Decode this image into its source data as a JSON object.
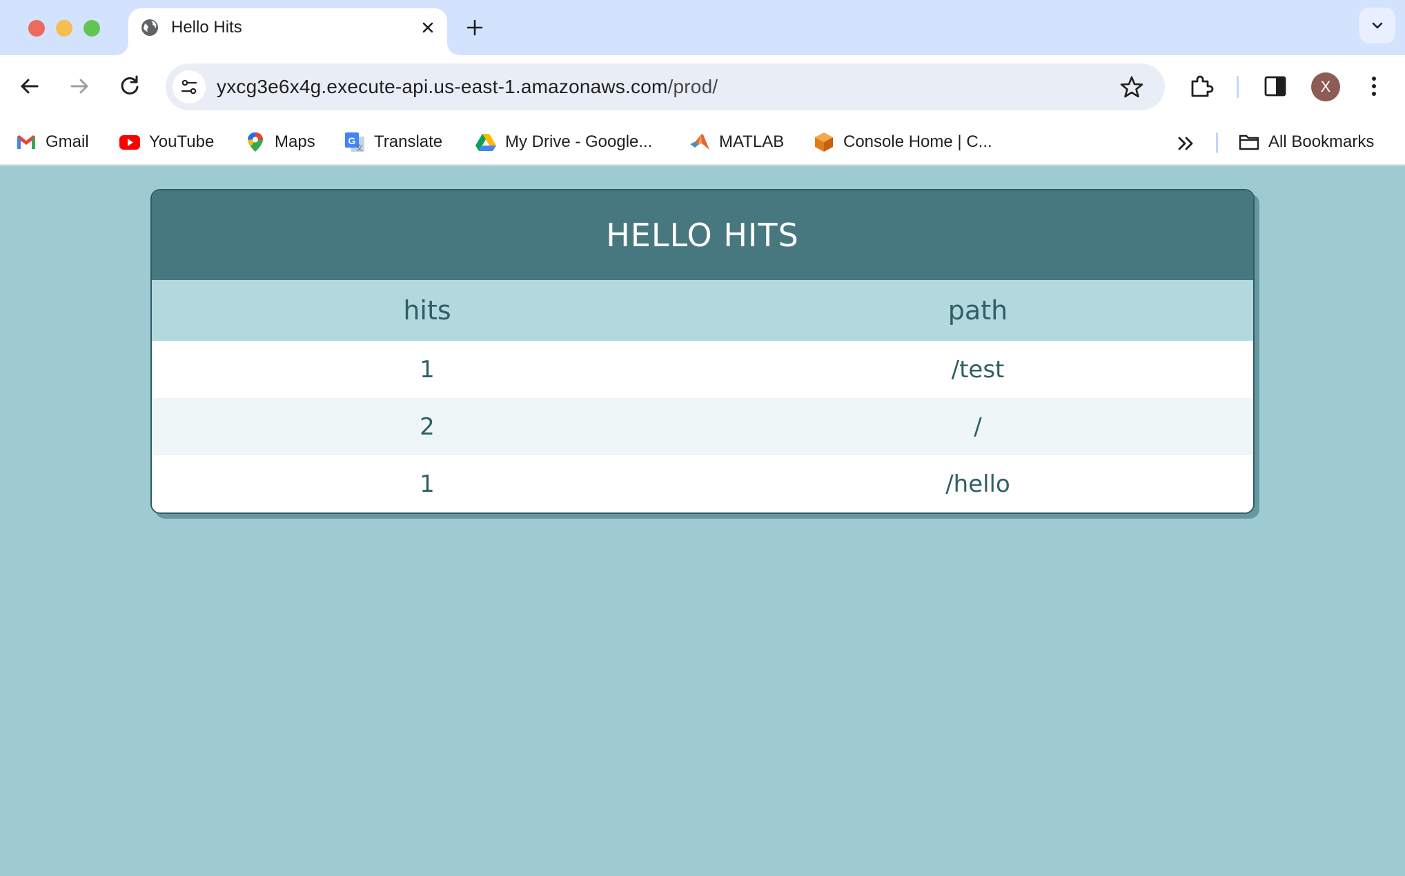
{
  "browser": {
    "tab_title": "Hello Hits",
    "url_host": "yxcg3e6x4g.execute-api.us-east-1.amazonaws.com",
    "url_path": "/prod/",
    "avatar_letter": "X",
    "bookmarks": [
      {
        "label": "Gmail",
        "icon": "gmail-icon"
      },
      {
        "label": "YouTube",
        "icon": "youtube-icon"
      },
      {
        "label": "Maps",
        "icon": "maps-icon"
      },
      {
        "label": "Translate",
        "icon": "translate-icon"
      },
      {
        "label": "My Drive - Google...",
        "icon": "drive-icon"
      },
      {
        "label": "MATLAB",
        "icon": "matlab-icon"
      },
      {
        "label": "Console Home | C...",
        "icon": "aws-cube-icon"
      }
    ],
    "all_bookmarks_label": "All Bookmarks"
  },
  "page": {
    "title": "HELLO HITS",
    "columns": [
      "hits",
      "path"
    ],
    "rows": [
      {
        "hits": "1",
        "path": "/test"
      },
      {
        "hits": "2",
        "path": "/"
      },
      {
        "hits": "1",
        "path": "/hello"
      }
    ]
  },
  "colors": {
    "page_background": "#9ecbd2",
    "header_background": "#48787f",
    "column_header_background": "#b2d9dd",
    "text": "#2f5f66"
  }
}
